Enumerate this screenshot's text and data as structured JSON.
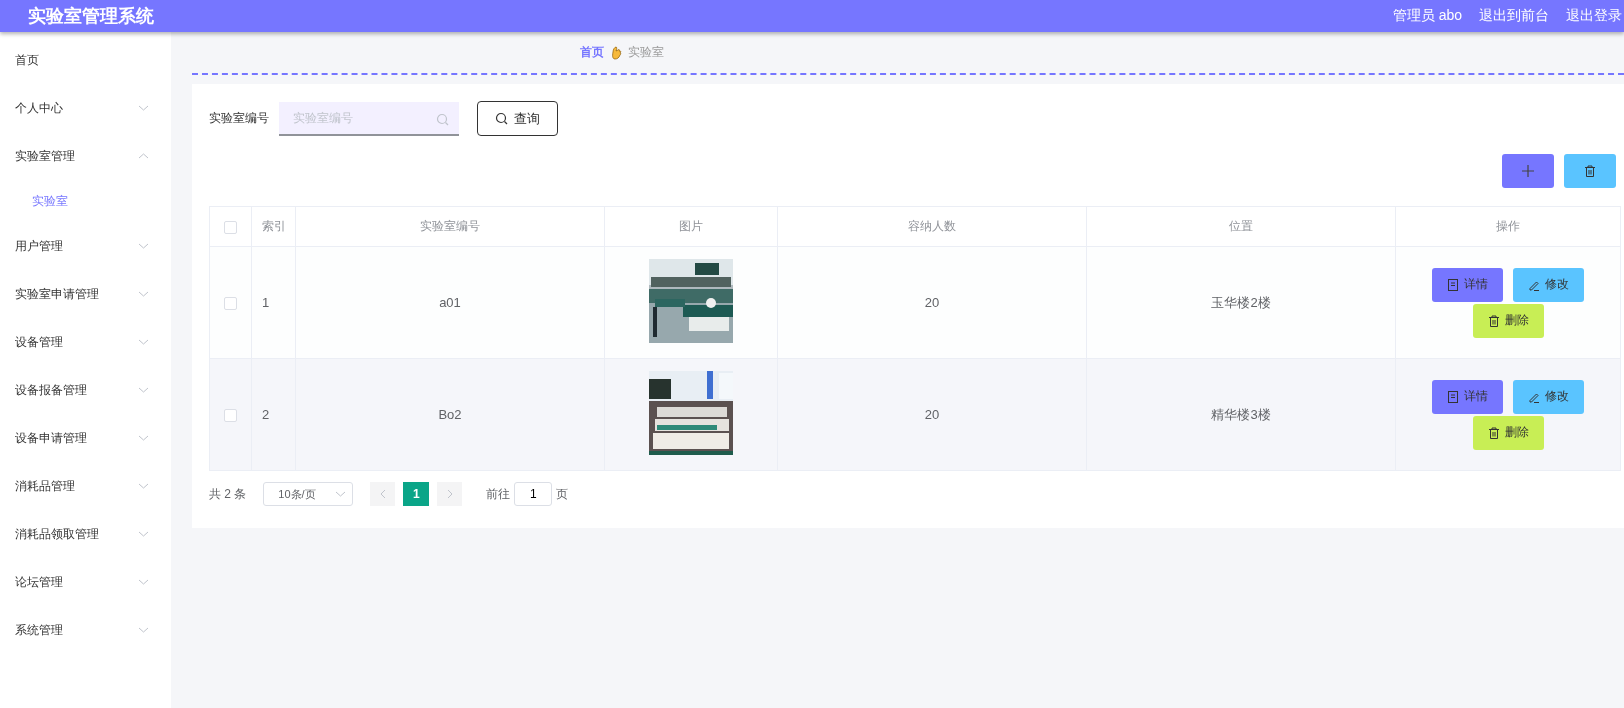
{
  "header": {
    "title": "实验室管理系统",
    "user": "管理员 abo",
    "links": [
      "退出到前台",
      "退出登录"
    ]
  },
  "sidebar": {
    "items": [
      {
        "kind": "link",
        "label": "首页"
      },
      {
        "kind": "menu",
        "label": "个人中心",
        "expanded": false
      },
      {
        "kind": "menu",
        "label": "实验室管理",
        "expanded": true,
        "children": [
          {
            "label": "实验室",
            "selected": true
          }
        ]
      },
      {
        "kind": "menu",
        "label": "用户管理",
        "expanded": false
      },
      {
        "kind": "menu",
        "label": "实验室申请管理",
        "expanded": false
      },
      {
        "kind": "menu",
        "label": "设备管理",
        "expanded": false
      },
      {
        "kind": "menu",
        "label": "设备报备管理",
        "expanded": false
      },
      {
        "kind": "menu",
        "label": "设备申请管理",
        "expanded": false
      },
      {
        "kind": "menu",
        "label": "消耗品管理",
        "expanded": false
      },
      {
        "kind": "menu",
        "label": "消耗品领取管理",
        "expanded": false
      },
      {
        "kind": "menu",
        "label": "论坛管理",
        "expanded": false
      },
      {
        "kind": "menu",
        "label": "系统管理",
        "expanded": false
      }
    ]
  },
  "breadcrumb": [
    "首页",
    "实验室"
  ],
  "search": {
    "label": "实验室编号",
    "placeholder": "实验室编号",
    "button": "查询"
  },
  "table": {
    "columns": [
      "索引",
      "实验室编号",
      "图片",
      "容纳人数",
      "位置",
      "操作"
    ],
    "all_checked": false,
    "rows": [
      {
        "checked": false,
        "index": "1",
        "code": "a01",
        "capacity": "20",
        "location": "玉华楼2楼",
        "actions": [
          {
            "kind": "detail",
            "label": "详情"
          },
          {
            "kind": "edit",
            "label": "修改"
          },
          {
            "kind": "delete",
            "label": "删除"
          }
        ]
      },
      {
        "checked": false,
        "index": "2",
        "code": "Bo2",
        "capacity": "20",
        "location": "精华楼3楼",
        "actions": [
          {
            "kind": "detail",
            "label": "详情"
          },
          {
            "kind": "edit",
            "label": "修改"
          },
          {
            "kind": "delete",
            "label": "删除"
          }
        ]
      }
    ]
  },
  "pagination": {
    "total": "共 2 条",
    "page_size": "10条/页",
    "pages": [
      {
        "label": "1",
        "selected": true
      }
    ],
    "goto_label": "前往",
    "goto_value": "1",
    "goto_suffix": "页"
  }
}
